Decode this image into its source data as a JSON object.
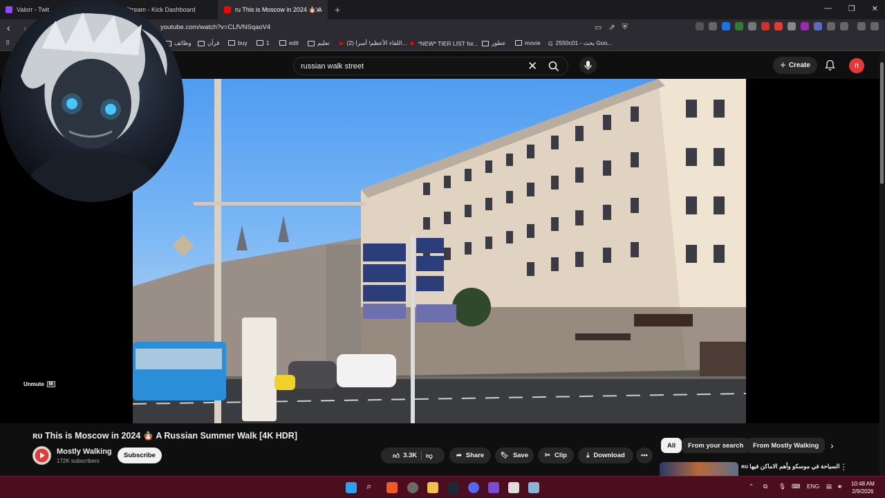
{
  "browser": {
    "tabs": [
      {
        "label": "Valorr - Twit",
        "favicon_color": "#9146ff",
        "active": false
      },
      {
        "label": "Stream - Kick Dashboard",
        "favicon_color": "#53fc18",
        "active": false
      },
      {
        "label": "ru This is Moscow in 2024 🪆 A",
        "favicon_color": "#ff0000",
        "active": true
      }
    ],
    "url": "youtube.com/watch?v=CLfVNSqaoV4",
    "bookmarks": [
      {
        "label": "وظائف",
        "icon": "folder-icon"
      },
      {
        "label": "قرآن",
        "icon": "folder-icon"
      },
      {
        "label": "buy",
        "icon": "folder-icon"
      },
      {
        "label": "1",
        "icon": "folder-icon"
      },
      {
        "label": "edit",
        "icon": "folder-icon"
      },
      {
        "label": "تعليم",
        "icon": "folder-icon"
      },
      {
        "label": "(2) اللقاء الأعظم! أسرا...",
        "icon": "youtube-icon"
      },
      {
        "label": "*NEW* TIER LIST for...",
        "icon": "youtube-icon"
      },
      {
        "label": "عطور",
        "icon": "folder-icon"
      },
      {
        "label": "movie",
        "icon": "folder-icon"
      },
      {
        "label": "2550c01 - بحث Goo...",
        "icon": "google-icon"
      }
    ]
  },
  "youtube": {
    "search_query": "russian walk street",
    "create_label": "Create",
    "user_initial": "п",
    "unmute_label": "Unmute",
    "unmute_key": "M",
    "video_title": "ʀᴜ This is Moscow in 2024 🪆 A Russian Summer Walk [4K HDR]",
    "channel_name": "Mostly Walking",
    "channel_subs": "172K subscribers",
    "subscribe_label": "Subscribe",
    "actions": {
      "likes": "3.3K",
      "share": "Share",
      "save": "Save",
      "clip": "Clip",
      "download": "Download"
    },
    "chips": [
      "All",
      "From your search",
      "From Mostly Walking"
    ],
    "recommendation_title": "ʀᴜ السياحة في موسكو وأهم الاماكن فيها",
    "colors": {
      "accent": "#ff0000",
      "background": "#0f0f0f",
      "taskbar": "#4a0e1f"
    }
  },
  "system": {
    "language": "ENG",
    "time": "10:48 AM",
    "date": "2/9/2026"
  }
}
